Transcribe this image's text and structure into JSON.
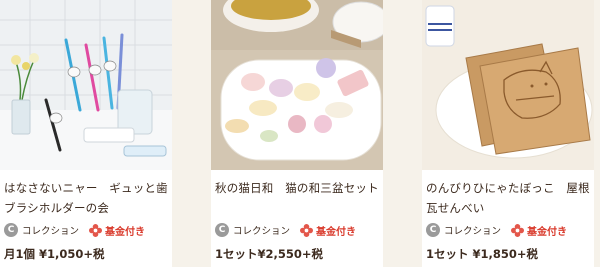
{
  "products": [
    {
      "title_line1": "はなさないニャー　ギュッと歯",
      "title_line2": "ブラシホルダーの会",
      "collection_label": "コレクション",
      "fund_label": "基金付き",
      "price": "月1個 ¥1,050+税",
      "image_icon": "toothbrush-holder-photo"
    },
    {
      "title_line1": "秋の猫日和　猫の和三盆セット",
      "title_line2": "",
      "collection_label": "コレクション",
      "fund_label": "基金付き",
      "price": "1セット¥2,550+税",
      "image_icon": "wasanbon-sweets-photo"
    },
    {
      "title_line1": "のんびりひにゃたぼっこ　屋根",
      "title_line2": "瓦せんべい",
      "collection_label": "コレクション",
      "fund_label": "基金付き",
      "price": "1セット ¥1,850+税",
      "image_icon": "cat-senbei-photo"
    }
  ],
  "colors": {
    "fund": "#d93a2c",
    "text": "#3c2a1e",
    "background": "#f6f2ea"
  }
}
